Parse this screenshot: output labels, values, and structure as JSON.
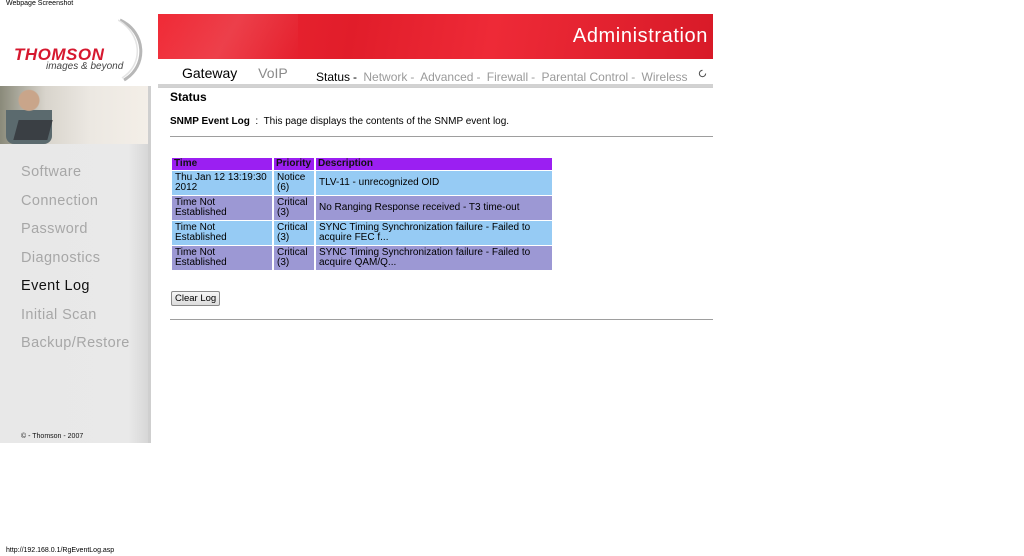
{
  "caption": "Webpage Screenshot",
  "footer_url": "http://192.168.0.1/RgEventLog.asp",
  "brand": {
    "logo": "THOMSON",
    "tagline": "images & beyond",
    "color": "#d6182f"
  },
  "header": {
    "title": "Administration",
    "banner_color": "#e11d2a"
  },
  "mainnav": [
    {
      "label": "Gateway",
      "active": true
    },
    {
      "label": "VoIP",
      "active": false
    }
  ],
  "subnav": [
    {
      "label": "Status",
      "current": true
    },
    {
      "label": "Network",
      "current": false
    },
    {
      "label": "Advanced",
      "current": false
    },
    {
      "label": "Firewall",
      "current": false
    },
    {
      "label": "Parental Control",
      "current": false
    },
    {
      "label": "Wireless",
      "current": false
    }
  ],
  "sidebar": {
    "items": [
      {
        "label": "Software",
        "active": false
      },
      {
        "label": "Connection",
        "active": false
      },
      {
        "label": "Password",
        "active": false
      },
      {
        "label": "Diagnostics",
        "active": false
      },
      {
        "label": "Event Log",
        "active": true
      },
      {
        "label": "Initial Scan",
        "active": false
      },
      {
        "label": "Backup/Restore",
        "active": false
      }
    ],
    "copyright": "© - Thomson - 2007"
  },
  "main": {
    "title": "Status",
    "intro_label": "SNMP Event Log",
    "intro_sep": ":",
    "intro_text": "This page displays the contents of the SNMP event log."
  },
  "log_table": {
    "headers": [
      "Time",
      "Priority",
      "Description"
    ],
    "header_color": "#9b1ff2",
    "rows": [
      {
        "time": "Thu Jan 12 13:19:30 2012",
        "priority": "Notice (6)",
        "description": "TLV-11 - unrecognized OID"
      },
      {
        "time": "Time Not Established",
        "priority": "Critical (3)",
        "description": "No Ranging Response received - T3 time-out"
      },
      {
        "time": "Time Not Established",
        "priority": "Critical (3)",
        "description": "SYNC Timing Synchronization failure - Failed to acquire FEC f..."
      },
      {
        "time": "Time Not Established",
        "priority": "Critical (3)",
        "description": "SYNC Timing Synchronization failure - Failed to acquire QAM/Q..."
      }
    ]
  },
  "clear_button": "Clear Log"
}
